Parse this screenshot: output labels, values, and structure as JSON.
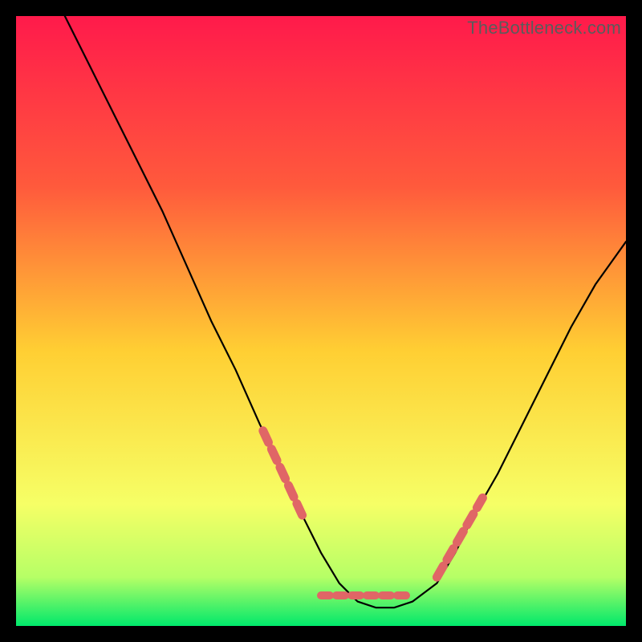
{
  "watermark": {
    "text": "TheBottleneck.com"
  },
  "chart_data": {
    "type": "line",
    "title": "",
    "xlabel": "",
    "ylabel": "",
    "xlim": [
      0,
      100
    ],
    "ylim": [
      0,
      100
    ],
    "grid": false,
    "legend": false,
    "series": [
      {
        "name": "curve",
        "x": [
          8,
          12,
          16,
          20,
          24,
          28,
          32,
          36,
          40,
          44,
          47,
          50,
          53,
          56,
          59,
          62,
          65,
          69,
          72,
          75,
          79,
          83,
          87,
          91,
          95,
          100
        ],
        "y": [
          100,
          92,
          84,
          76,
          68,
          59,
          50,
          42,
          33,
          25,
          18,
          12,
          7,
          4,
          3,
          3,
          4,
          7,
          12,
          18,
          25,
          33,
          41,
          49,
          56,
          63
        ]
      }
    ],
    "highlight_segments": [
      {
        "dir": "left",
        "x": [
          40.5,
          47.0
        ],
        "y": [
          32.0,
          18.0
        ]
      },
      {
        "dir": "floor",
        "x": [
          50.0,
          65.0
        ],
        "y": [
          5.0,
          5.0
        ]
      },
      {
        "dir": "right",
        "x": [
          69.0,
          76.5
        ],
        "y": [
          8.0,
          21.0
        ]
      }
    ],
    "colors": {
      "curve": "#000000",
      "highlight": "#e06666",
      "gradient_top": "#ff1a4b",
      "gradient_upper": "#ff5a3c",
      "gradient_mid": "#ffcf33",
      "gradient_lower": "#f6ff66",
      "gradient_bottom": "#00e86b",
      "frame": "#000000"
    }
  }
}
